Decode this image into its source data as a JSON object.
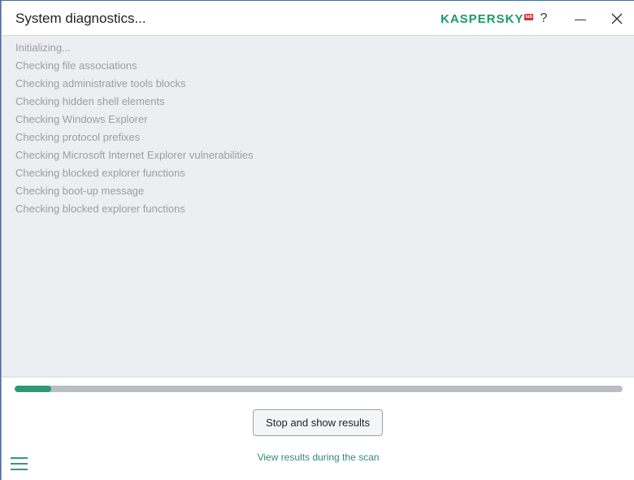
{
  "window": {
    "title": "System diagnostics...",
    "logo_text": "KASPERSKY",
    "logo_badge": "lab",
    "help_label": "?",
    "minimize_icon": "minimize-icon",
    "close_icon": "close-icon"
  },
  "log": {
    "lines": [
      "Initializing...",
      "Checking file associations",
      "Checking administrative tools blocks",
      "Checking hidden shell elements",
      "Checking Windows Explorer",
      "Checking protocol prefixes",
      "Checking Microsoft Internet Explorer vulnerabilities",
      "Checking blocked explorer functions",
      "Checking boot-up message",
      "Checking blocked explorer functions"
    ]
  },
  "progress": {
    "fraction": 0.06
  },
  "actions": {
    "stop_label": "Stop and show results",
    "view_results_label": "View results during the scan"
  },
  "colors": {
    "accent": "#2f9a72",
    "link": "#2f8a7a",
    "logo": "#1a9a6a"
  }
}
